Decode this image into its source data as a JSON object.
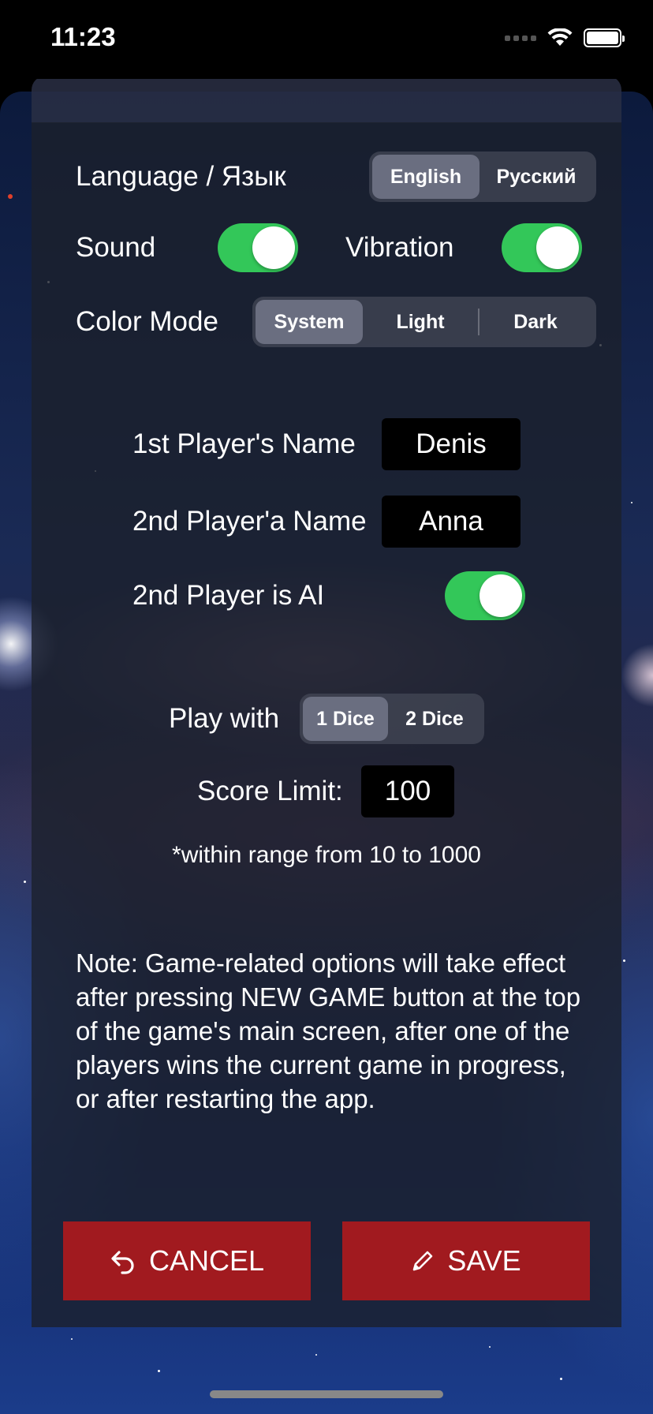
{
  "status_bar": {
    "time": "11:23"
  },
  "settings": {
    "language_label": "Language / Язык",
    "language_options": [
      "English",
      "Русский"
    ],
    "language_selected": "English",
    "sound_label": "Sound",
    "vibration_label": "Vibration",
    "color_mode_label": "Color Mode",
    "color_mode_options": [
      "System",
      "Light",
      "Dark"
    ],
    "color_mode_selected": "System"
  },
  "players": {
    "first_label": "1st Player's Name",
    "first_value": "Denis",
    "second_label": "2nd Player'a Name",
    "second_value": "Anna",
    "ai_label": "2nd Player is AI"
  },
  "game": {
    "play_with_label": "Play with",
    "dice_options": [
      "1 Dice",
      "2 Dice"
    ],
    "dice_selected": "1 Dice",
    "score_limit_label": "Score Limit:",
    "score_limit_value": "100",
    "range_note": "*within range from 10 to 1000"
  },
  "note": "Note: Game-related options will take effect after pressing NEW GAME button at the top of the game's main screen, after one of the players wins the current game in progress, or after restarting the app.",
  "buttons": {
    "cancel": "CANCEL",
    "save": "SAVE"
  },
  "colors": {
    "toggle_on": "#33c759",
    "button_red": "#a11a1f"
  }
}
